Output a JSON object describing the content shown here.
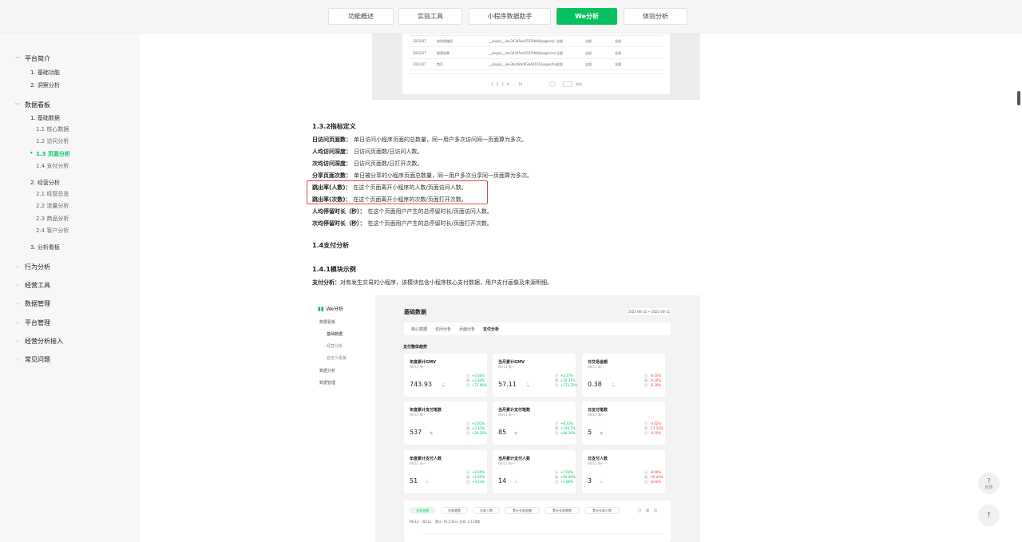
{
  "nav": {
    "tabs": [
      {
        "label": "功能概述",
        "active": false
      },
      {
        "label": "实验工具",
        "active": false
      },
      {
        "label": "小程序数据助手",
        "active": false
      },
      {
        "label": "We分析",
        "active": true
      },
      {
        "label": "体验分析",
        "active": false
      }
    ]
  },
  "sidebar": {
    "platform_intro": "平台简介",
    "basic_functions": "1. 基础功能",
    "funnel_analysis": "2. 洞察分析",
    "data_board": "数据看板",
    "basic_data": "1. 基础数据",
    "core_data": "1.1 核心数据",
    "visit_analysis": "1.2 访问分析",
    "page_analysis": "1.3 页面分析",
    "payment_analysis": "1.4 支付分析",
    "business_analysis": "2. 经营分析",
    "business_overview": "2.1 经营总览",
    "traffic_analysis": "2.2 流量分析",
    "product_analysis": "2.3 商品分析",
    "customer_analysis": "2.4 客户分析",
    "analysis_board": "3. 分析看板",
    "behavior_analysis": "行为分析",
    "business_tools": "经营工具",
    "data_management": "数据管理",
    "platform_management": "平台管理",
    "business_access": "经营分析接入",
    "faq": "常见问题"
  },
  "top_table": {
    "rows": [
      {
        "date": "2021/07",
        "name": "体验版路径",
        "path": "__plugin__/wx34345ae5555fbb0/pages/a/",
        "a": "全部",
        "b": "全部",
        "c": "全部"
      },
      {
        "date": "2021/07",
        "name": "搜索结果",
        "path": "__plugin__/wx34345ae5555fbb0/pages/re/",
        "a": "全部",
        "b": "全部",
        "c": "全部"
      },
      {
        "date": "2021/07",
        "name": "首页",
        "path": "__plugin__/wx3bcb8ddd3e44101/pages/ha/",
        "a": "全部",
        "b": "全部",
        "c": "全部"
      }
    ],
    "pagination": [
      "1",
      "2",
      "3",
      "4",
      "...",
      "10"
    ],
    "goto": "跳转"
  },
  "section": {
    "h132": "1.3.2指标定义",
    "defs": [
      {
        "term": "日访问页面数：",
        "desc": "单日访问小程序页面的总数量，同一用户多次访问同一页面算为多次。"
      },
      {
        "term": "人均访问深度：",
        "desc": "日访问页面数/日访问人数。"
      },
      {
        "term": "次均访问深度：",
        "desc": "日访问页面数/日打开次数。"
      },
      {
        "term": "分享页面次数：",
        "desc": "单日被分享的小程序页面总数量，同一用户多次分享同一页面算为多次。"
      },
      {
        "term": "跳出率(人数)：",
        "desc": "在这个页面离开小程序的人数/页面访问人数。"
      },
      {
        "term": "跳出率(次数)：",
        "desc": "在这个页面离开小程序的次数/页面打开次数。"
      },
      {
        "term": "人均停留时长（秒）：",
        "desc": "在这个页面用户产生的总停留时长/页面访问人数。"
      },
      {
        "term": "次均停留时长（秒）：",
        "desc": "在这个页面用户产生的总停留时长/页面打开次数。"
      }
    ],
    "h14": "1.4支付分析",
    "h141": "1.4.1模块示例",
    "pay_term": "支付分析：",
    "pay_desc": "对有发生交易的小程序，该模块包含小程序核心支付数据，用户支付画像及来源明细。"
  },
  "shot": {
    "logo": "We分析",
    "menu_data_board": "数据看板",
    "menu_basic": "基础数据",
    "menu_business": "经营分析",
    "menu_custom": "自定义看板",
    "menu_analysis": "数据分析",
    "menu_manage": "数据管理",
    "title": "基础数据",
    "date_range": "2021-06-15 ~ 2021-06-11",
    "tabs": [
      "核心数据",
      "访问分析",
      "页面分析",
      "支付分析"
    ],
    "overall": "支付整体趋势",
    "cards": [
      {
        "title": "年度累计GMV",
        "sub": "06/11 周一",
        "value": "743.93",
        "unit": "元",
        "c1": "+3.00%",
        "c2": "+2.84%",
        "c3": "+72.96%",
        "col": [
          "g",
          "g",
          "g"
        ]
      },
      {
        "title": "当月累计GMV",
        "sub": "06/11 周一",
        "value": "57.11",
        "unit": "元",
        "c1": "+2.37%",
        "c2": "+50.37%",
        "c3": "+275.23%",
        "col": [
          "g",
          "g",
          "g"
        ]
      },
      {
        "title": "日交易金额",
        "sub": "06/11 周一",
        "value": "0.38",
        "unit": "元",
        "c1": "-8.10%",
        "c2": "-9.30%",
        "c3": "-8.30%",
        "col": [
          "r",
          "r",
          "r"
        ]
      },
      {
        "title": "年度累计支付笔数",
        "sub": "06/11 周一",
        "value": "537",
        "unit": "笔",
        "c1": "+2.81%",
        "c2": "+3.31%",
        "c3": "+26.26%",
        "col": [
          "g",
          "g",
          "g"
        ]
      },
      {
        "title": "当月累计支付笔数",
        "sub": "06/11 周一",
        "value": "85",
        "unit": "笔",
        "c1": "+6.33%",
        "c2": "+106.7%",
        "c3": "+80.39%",
        "col": [
          "g",
          "g",
          "g"
        ]
      },
      {
        "title": "日支付笔数",
        "sub": "06/11 周一",
        "value": "5",
        "unit": "笔",
        "c1": "-4.02%",
        "c2": "-17.50%",
        "c3": "-4.10%",
        "col": [
          "r",
          "r",
          "r"
        ]
      },
      {
        "title": "年度累计支付人数",
        "sub": "06/11 周一",
        "value": "51",
        "unit": "人",
        "c1": "+2.60%",
        "c2": "+2.95%",
        "c3": "+3.23%",
        "col": [
          "g",
          "g",
          "g"
        ]
      },
      {
        "title": "当月累计支付人数",
        "sub": "06/11 周一",
        "value": "14",
        "unit": "人",
        "c1": "+7.69%",
        "c2": "+40.00%",
        "c3": "+1.80%",
        "col": [
          "g",
          "g",
          "g"
        ]
      },
      {
        "title": "日支付人数",
        "sub": "06/11 周一",
        "value": "3",
        "unit": "人",
        "c1": "-8.00%",
        "c2": "-40.00%",
        "c3": "-8.00%",
        "col": [
          "r",
          "r",
          "r"
        ]
      }
    ],
    "row_labels": [
      "日",
      "周",
      "月"
    ],
    "chips": [
      "交易金额",
      "交易笔数",
      "交易人数",
      "累计交易金额",
      "累计交易笔数",
      "累计交易人数"
    ],
    "chip_right": [
      "日",
      "周",
      "月"
    ],
    "range_text": "06/12 - 06/12",
    "range_sum": "累计: ¥1,536元",
    "range_cnt": "交易: 4,118笔"
  },
  "float": {
    "help_q": "?",
    "help_label": "反馈",
    "top_icon": "↑"
  }
}
